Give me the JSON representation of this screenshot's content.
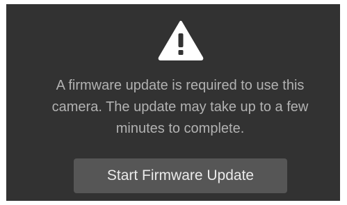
{
  "dialog": {
    "icon": "warning-triangle-icon",
    "message_line1": "A firmware update is required to use this",
    "message_line2": "camera. The update may take up to a few",
    "message_line3": "minutes to complete.",
    "button_label": "Start Firmware Update"
  },
  "colors": {
    "background": "#323232",
    "text": "#b2b2b2",
    "button": "#565656",
    "icon": "#ffffff"
  }
}
